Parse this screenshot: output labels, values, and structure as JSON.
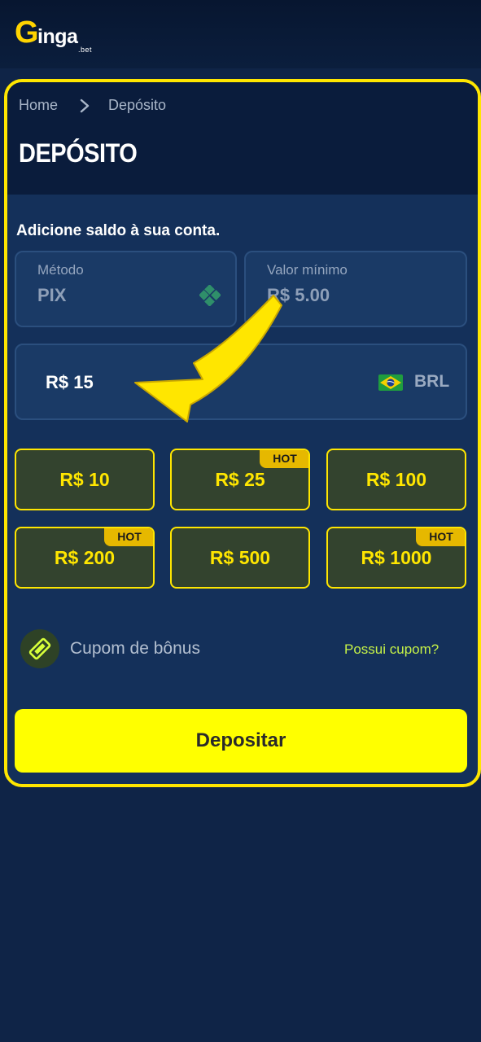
{
  "header": {
    "logo_letter": "G",
    "logo_rest": "inga",
    "logo_suffix": ".bet"
  },
  "breadcrumb": {
    "home": "Home",
    "current": "Depósito"
  },
  "page": {
    "title": "DEPÓSITO",
    "subtitle": "Adicione saldo à sua conta."
  },
  "method": {
    "label": "Método",
    "value": "PIX",
    "icon": "pix-icon"
  },
  "min_value": {
    "label": "Valor mínimo",
    "value": "R$ 5.00"
  },
  "amount": {
    "value": "R$ 15",
    "currency": "BRL",
    "flag_icon": "brazil-flag-icon"
  },
  "presets": [
    {
      "label": "R$ 10",
      "hot": false
    },
    {
      "label": "R$ 25",
      "hot": true
    },
    {
      "label": "R$ 100",
      "hot": false
    },
    {
      "label": "R$ 200",
      "hot": true
    },
    {
      "label": "R$ 500",
      "hot": false
    },
    {
      "label": "R$ 1000",
      "hot": true
    }
  ],
  "hot_badge": "HOT",
  "coupon": {
    "label": "Cupom de bônus",
    "link": "Possui cupom?",
    "icon": "ticket-icon"
  },
  "deposit_button": "Depositar",
  "colors": {
    "accent": "#ffe600",
    "background": "#0f2447",
    "panel": "#14305a",
    "chip": "#33432e",
    "hot": "#e6b800",
    "link": "#c6f247"
  }
}
